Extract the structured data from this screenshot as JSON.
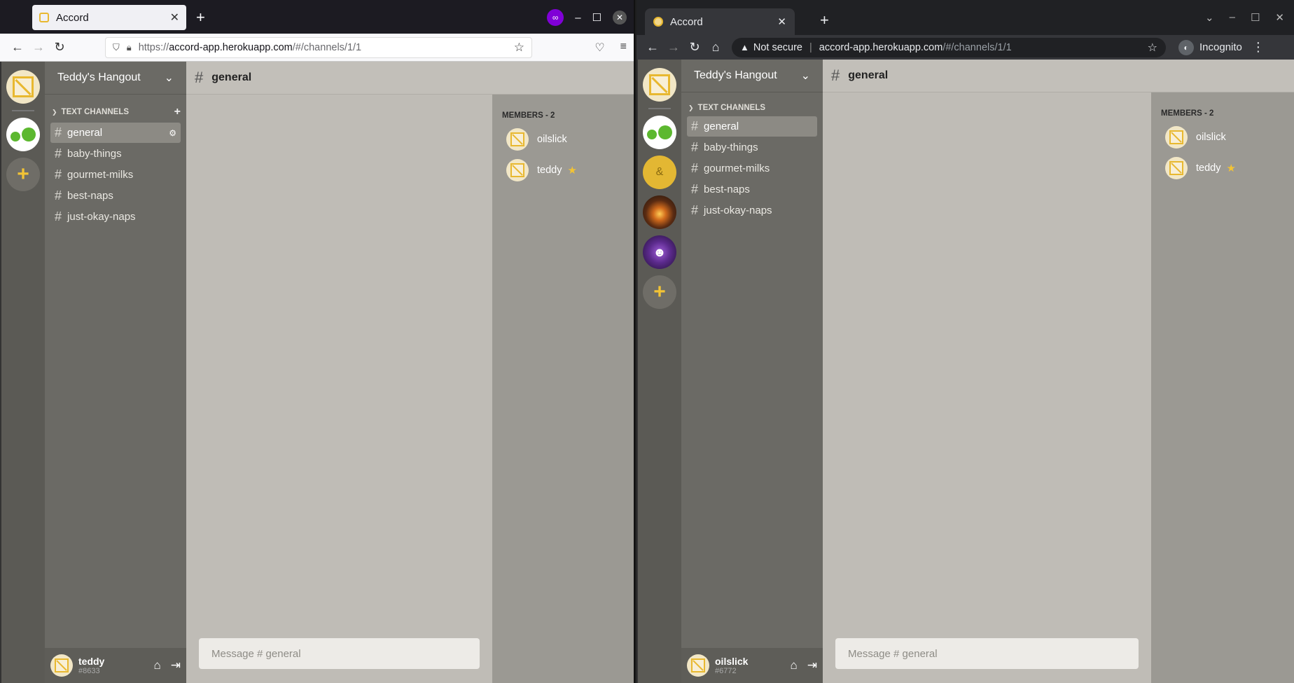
{
  "left_browser": {
    "tab_title": "Accord",
    "url_prefix": "https://",
    "url_host": "accord-app.herokuapp.com",
    "url_path": "/#/channels/1/1"
  },
  "right_browser": {
    "tab_title": "Accord",
    "security_label": "Not secure",
    "url_host": "accord-app.herokuapp.com",
    "url_path": "/#/channels/1/1",
    "incognito_label": "Incognito"
  },
  "left_app": {
    "server_name": "Teddy's Hangout",
    "category": "TEXT CHANNELS",
    "channels": [
      "general",
      "baby-things",
      "gourmet-milks",
      "best-naps",
      "just-okay-naps"
    ],
    "active_channel": "general",
    "input_placeholder": "Message # general",
    "members_title": "MEMBERS - 2",
    "members": [
      "oilslick",
      "teddy"
    ],
    "user": {
      "name": "teddy",
      "tag": "#8633"
    }
  },
  "right_app": {
    "server_name": "Teddy's Hangout",
    "category": "TEXT CHANNELS",
    "channels": [
      "general",
      "baby-things",
      "gourmet-milks",
      "best-naps",
      "just-okay-naps"
    ],
    "active_channel": "general",
    "input_placeholder": "Message # general",
    "members_title": "MEMBERS - 2",
    "members": [
      "oilslick",
      "teddy"
    ],
    "user": {
      "name": "oilslick",
      "tag": "#6772"
    }
  },
  "colors": {
    "accent": "#e8b830",
    "firefox_private": "#8000d7"
  }
}
